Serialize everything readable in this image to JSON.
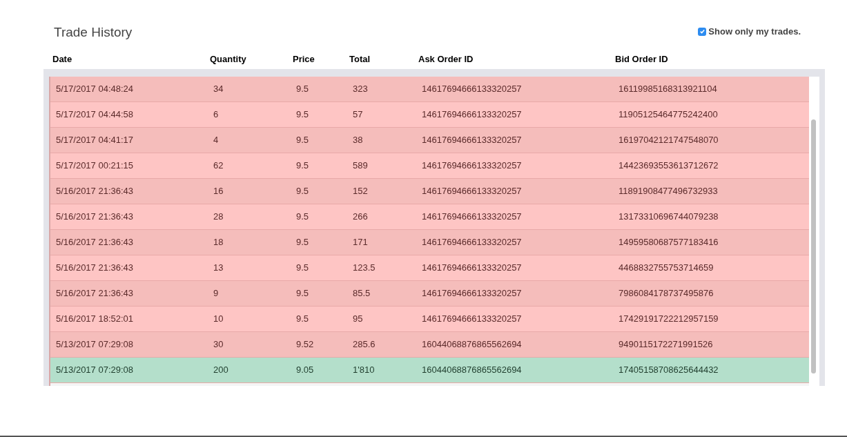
{
  "title": "Trade History",
  "filter": {
    "label": "Show only my trades.",
    "checked": true
  },
  "table": {
    "columns": [
      "Date",
      "Quantity",
      "Price",
      "Total",
      "Ask Order ID",
      "Bid Order ID"
    ],
    "rows": [
      {
        "kind": "sell",
        "cells": [
          "5/17/2017 04:48:24",
          "34",
          "9.5",
          "323",
          "14617694666133320257",
          "16119985168313921104"
        ]
      },
      {
        "kind": "sell",
        "cells": [
          "5/17/2017 04:44:58",
          "6",
          "9.5",
          "57",
          "14617694666133320257",
          "11905125464775242400"
        ]
      },
      {
        "kind": "sell",
        "cells": [
          "5/17/2017 04:41:17",
          "4",
          "9.5",
          "38",
          "14617694666133320257",
          "16197042121747548070"
        ]
      },
      {
        "kind": "sell",
        "cells": [
          "5/17/2017 00:21:15",
          "62",
          "9.5",
          "589",
          "14617694666133320257",
          "14423693553613712672"
        ]
      },
      {
        "kind": "sell",
        "cells": [
          "5/16/2017 21:36:43",
          "16",
          "9.5",
          "152",
          "14617694666133320257",
          "11891908477496732933"
        ]
      },
      {
        "kind": "sell",
        "cells": [
          "5/16/2017 21:36:43",
          "28",
          "9.5",
          "266",
          "14617694666133320257",
          "13173310696744079238"
        ]
      },
      {
        "kind": "sell",
        "cells": [
          "5/16/2017 21:36:43",
          "18",
          "9.5",
          "171",
          "14617694666133320257",
          "14959580687577183416"
        ]
      },
      {
        "kind": "sell",
        "cells": [
          "5/16/2017 21:36:43",
          "13",
          "9.5",
          "123.5",
          "14617694666133320257",
          "4468832755753714659"
        ]
      },
      {
        "kind": "sell",
        "cells": [
          "5/16/2017 21:36:43",
          "9",
          "9.5",
          "85.5",
          "14617694666133320257",
          "7986084178737495876"
        ]
      },
      {
        "kind": "sell",
        "cells": [
          "5/16/2017 18:52:01",
          "10",
          "9.5",
          "95",
          "14617694666133320257",
          "17429191722212957159"
        ]
      },
      {
        "kind": "sell",
        "cells": [
          "5/13/2017 07:29:08",
          "30",
          "9.52",
          "285.6",
          "16044068876865562694",
          "9490115172271991526"
        ]
      },
      {
        "kind": "buy",
        "cells": [
          "5/13/2017 07:29:08",
          "200",
          "9.05",
          "1'810",
          "16044068876865562694",
          "17405158708625644432"
        ]
      }
    ]
  }
}
